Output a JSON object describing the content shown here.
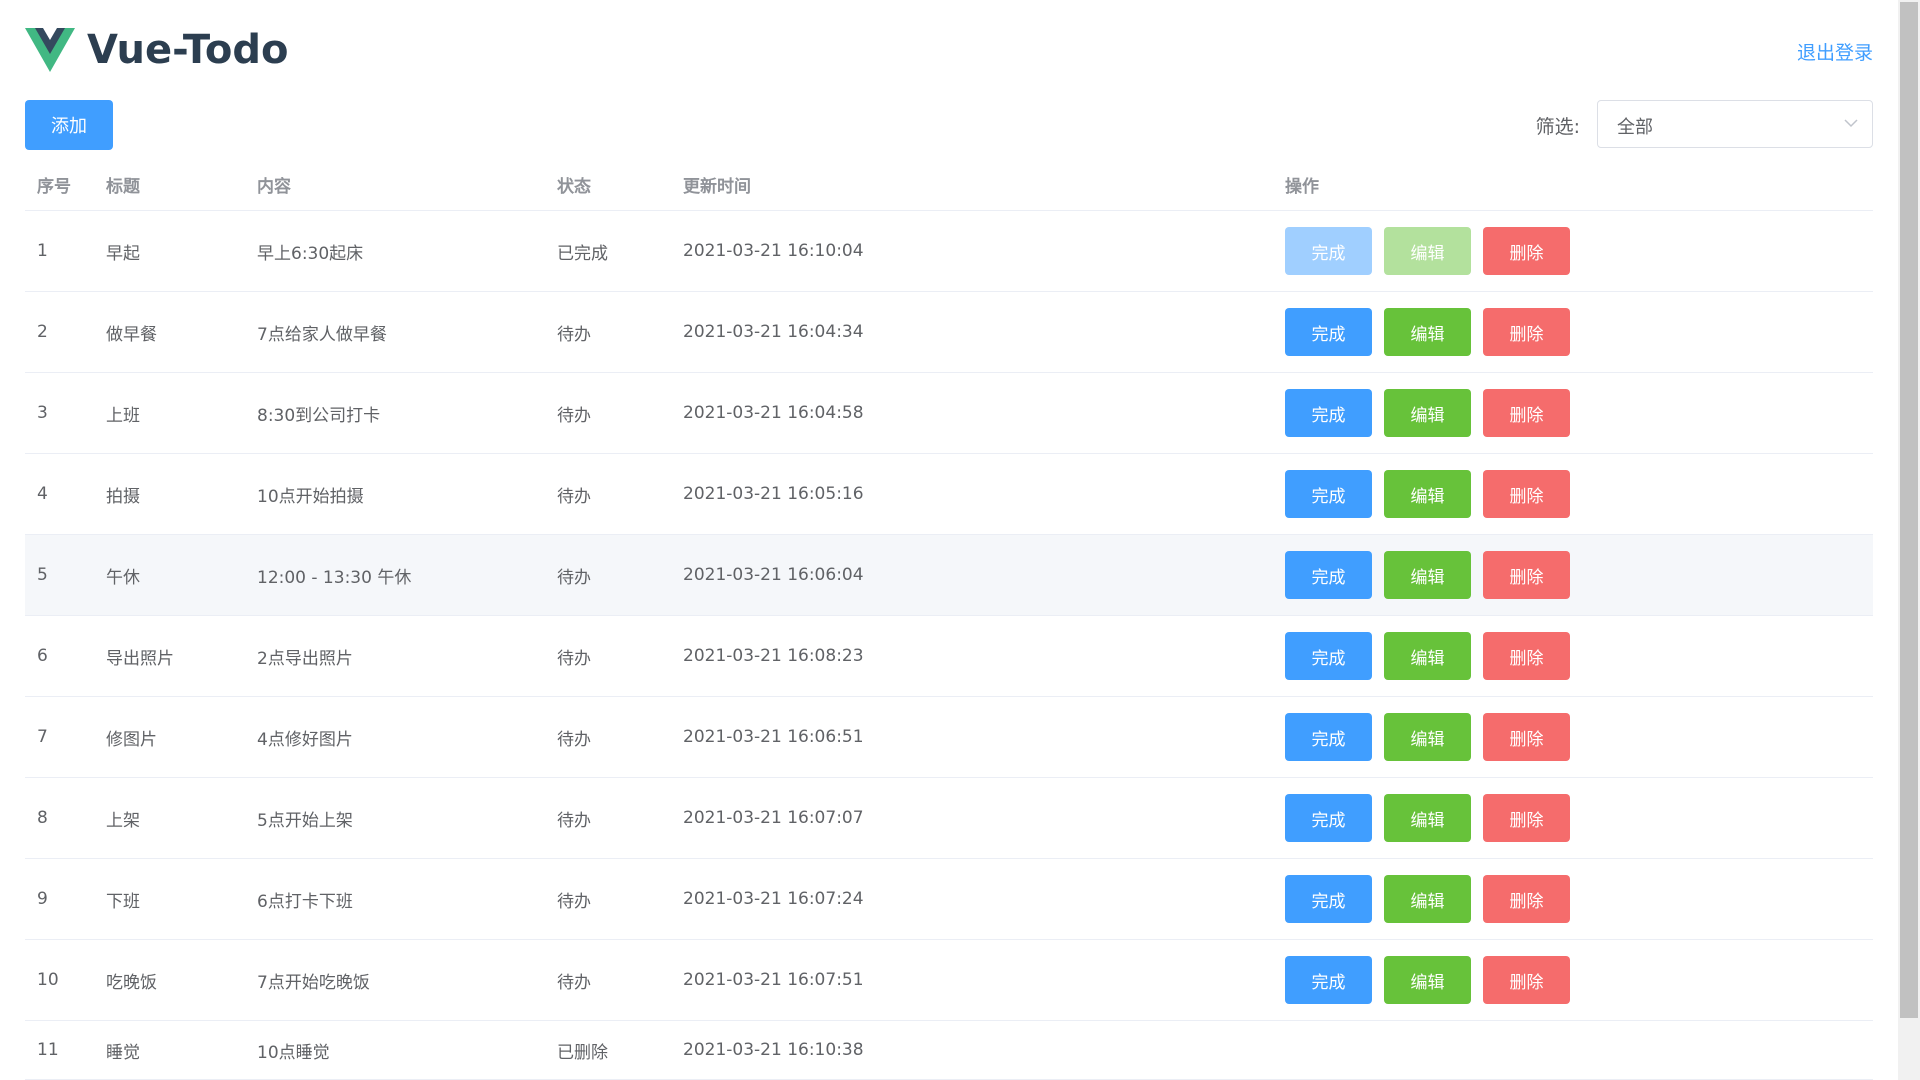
{
  "header": {
    "title": "Vue-Todo",
    "logout_label": "退出登录"
  },
  "toolbar": {
    "add_label": "添加",
    "filter_label": "筛选:",
    "filter_value": "全部"
  },
  "colors": {
    "primary": "#409eff",
    "success": "#67c23a",
    "danger": "#f56c6c",
    "logo_green": "#41b883",
    "logo_dark": "#34495e"
  },
  "table": {
    "columns": [
      "序号",
      "标题",
      "内容",
      "状态",
      "更新时间",
      "操作"
    ],
    "actions": {
      "complete": "完成",
      "edit": "编辑",
      "delete": "删除"
    },
    "rows": [
      {
        "id": "1",
        "title": "早起",
        "content": "早上6:30起床",
        "status": "已完成",
        "time": "2021-03-21 16:10:04",
        "actions_state": "disabled"
      },
      {
        "id": "2",
        "title": "做早餐",
        "content": "7点给家人做早餐",
        "status": "待办",
        "time": "2021-03-21 16:04:34",
        "actions_state": "enabled"
      },
      {
        "id": "3",
        "title": "上班",
        "content": "8:30到公司打卡",
        "status": "待办",
        "time": "2021-03-21 16:04:58",
        "actions_state": "enabled"
      },
      {
        "id": "4",
        "title": "拍摄",
        "content": "10点开始拍摄",
        "status": "待办",
        "time": "2021-03-21 16:05:16",
        "actions_state": "enabled"
      },
      {
        "id": "5",
        "title": "午休",
        "content": "12:00 - 13:30 午休",
        "status": "待办",
        "time": "2021-03-21 16:06:04",
        "actions_state": "enabled"
      },
      {
        "id": "6",
        "title": "导出照片",
        "content": "2点导出照片",
        "status": "待办",
        "time": "2021-03-21 16:08:23",
        "actions_state": "enabled"
      },
      {
        "id": "7",
        "title": "修图片",
        "content": "4点修好图片",
        "status": "待办",
        "time": "2021-03-21 16:06:51",
        "actions_state": "enabled"
      },
      {
        "id": "8",
        "title": "上架",
        "content": "5点开始上架",
        "status": "待办",
        "time": "2021-03-21 16:07:07",
        "actions_state": "enabled"
      },
      {
        "id": "9",
        "title": "下班",
        "content": "6点打卡下班",
        "status": "待办",
        "time": "2021-03-21 16:07:24",
        "actions_state": "enabled"
      },
      {
        "id": "10",
        "title": "吃晚饭",
        "content": "7点开始吃晚饭",
        "status": "待办",
        "time": "2021-03-21 16:07:51",
        "actions_state": "enabled"
      },
      {
        "id": "11",
        "title": "睡觉",
        "content": "10点睡觉",
        "status": "已删除",
        "time": "2021-03-21 16:10:38",
        "actions_state": "none"
      }
    ]
  }
}
